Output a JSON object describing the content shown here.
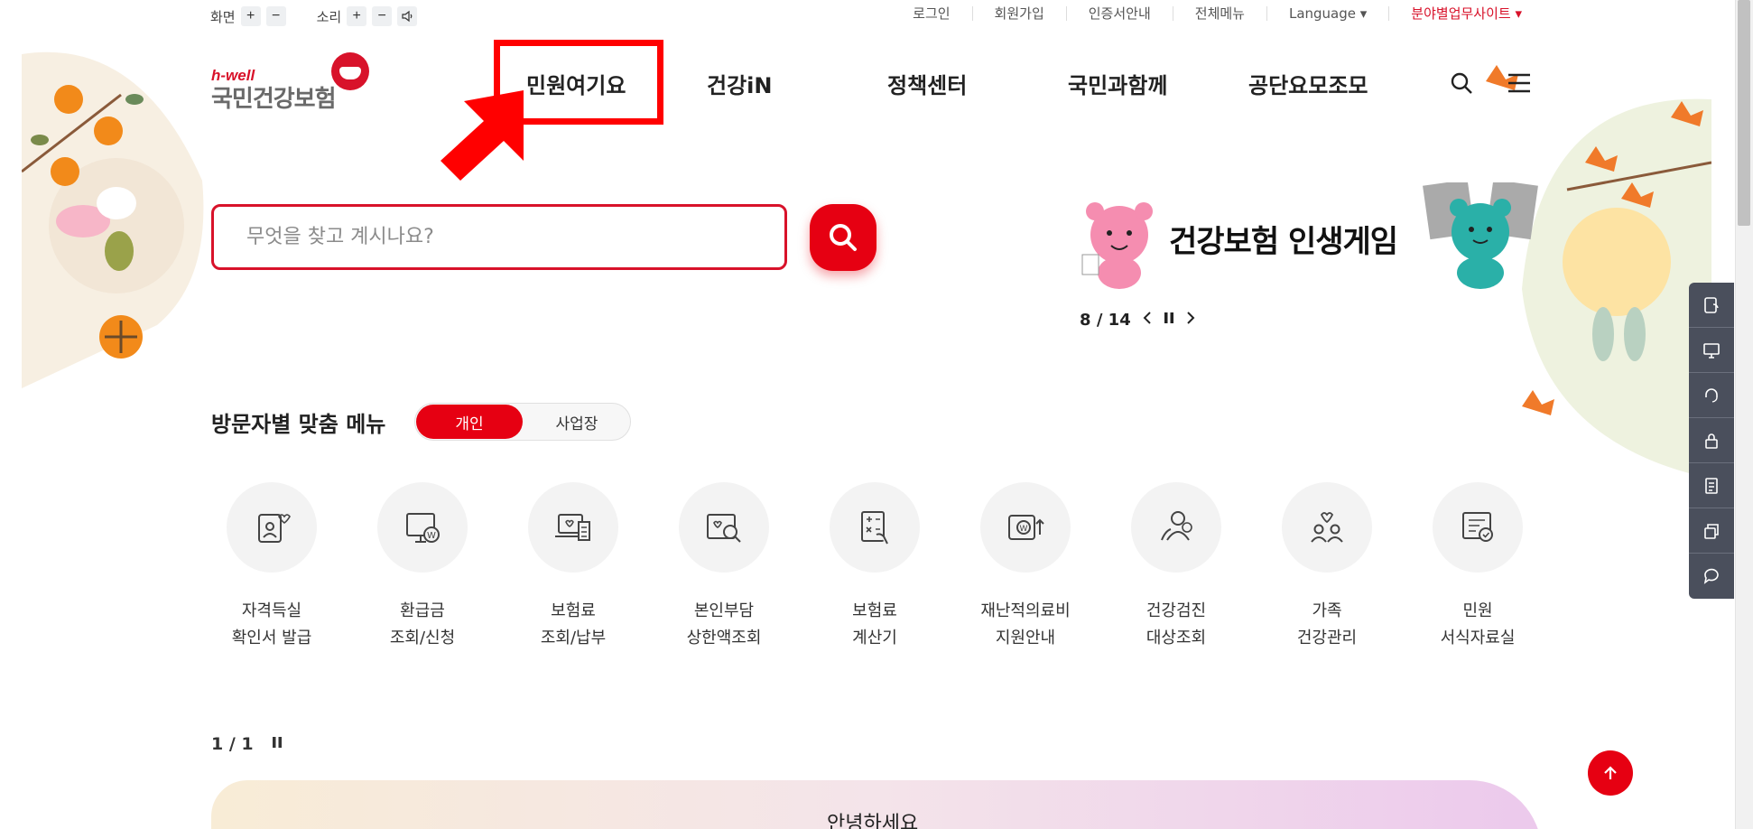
{
  "utility": {
    "screen_label": "화면",
    "sound_label": "소리",
    "plus": "+",
    "minus": "−",
    "links": [
      "로그인",
      "회원가입",
      "인증서안내",
      "전체메뉴",
      "Language ▾",
      "분야별업무사이트 ▾"
    ]
  },
  "logo": {
    "tagline": "h-well",
    "name": "국민건강보험"
  },
  "gnb": {
    "items": [
      "민원여기요",
      "건강iN",
      "정책센터",
      "국민과함께",
      "공단요모조모"
    ]
  },
  "search": {
    "placeholder": "무엇을 찾고 계시나요?"
  },
  "banner": {
    "title": "건강보험 인생게임",
    "pager": {
      "current": "8",
      "separator": "/",
      "total": "14"
    }
  },
  "visitor_menu": {
    "title": "방문자별 맞춤 메뉴",
    "toggle": {
      "active": "개인",
      "inactive": "사업장"
    },
    "items": [
      {
        "line1": "자격득실",
        "line2": "확인서 발급",
        "icon": "id-card-heart-icon"
      },
      {
        "line1": "환급금",
        "line2": "조회/신청",
        "icon": "monitor-won-icon"
      },
      {
        "line1": "보험료",
        "line2": "조회/납부",
        "icon": "laptop-receipt-icon"
      },
      {
        "line1": "본인부담",
        "line2": "상한액조회",
        "icon": "heart-search-icon"
      },
      {
        "line1": "보험료",
        "line2": "계산기",
        "icon": "calculator-hand-icon"
      },
      {
        "line1": "재난적의료비",
        "line2": "지원안내",
        "icon": "wallet-won-icon"
      },
      {
        "line1": "건강검진",
        "line2": "대상조회",
        "icon": "people-check-icon"
      },
      {
        "line1": "가족",
        "line2": "건강관리",
        "icon": "family-heart-icon"
      },
      {
        "line1": "민원",
        "line2": "서식자료실",
        "icon": "document-check-icon"
      }
    ]
  },
  "slide_pager": {
    "text": "1 / 1"
  },
  "bottom_banner": {
    "text": "안녕하세요"
  },
  "quick_bar": [
    "app-icon",
    "monitor-icon",
    "headset-icon",
    "lock-icon",
    "document-icon",
    "copy-icon",
    "chat-icon"
  ],
  "colors": {
    "brand_red": "#e60012",
    "highlight_red": "#ff0000",
    "quick_bar_bg": "#4a4f5c"
  }
}
